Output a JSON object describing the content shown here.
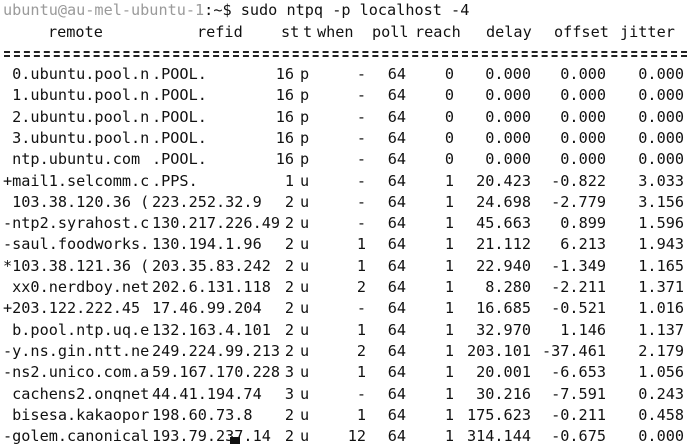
{
  "prompt": {
    "user_host": "ubuntu@au-mel-ubuntu-1",
    "path_symbol": ":~$",
    "command": " sudo ntpq -p localhost -4"
  },
  "columns": [
    "remote",
    "refid",
    "st",
    "t",
    "when",
    "poll",
    "reach",
    "delay",
    "offset",
    "jitter"
  ],
  "rows": [
    {
      "remote": " 0.ubuntu.pool.n",
      "refid": ".POOL.",
      "st": "16",
      "t": "p",
      "when": "-",
      "poll": "64",
      "reach": "0",
      "delay": "0.000",
      "offset": "0.000",
      "jitter": "0.000"
    },
    {
      "remote": " 1.ubuntu.pool.n",
      "refid": ".POOL.",
      "st": "16",
      "t": "p",
      "when": "-",
      "poll": "64",
      "reach": "0",
      "delay": "0.000",
      "offset": "0.000",
      "jitter": "0.000"
    },
    {
      "remote": " 2.ubuntu.pool.n",
      "refid": ".POOL.",
      "st": "16",
      "t": "p",
      "when": "-",
      "poll": "64",
      "reach": "0",
      "delay": "0.000",
      "offset": "0.000",
      "jitter": "0.000"
    },
    {
      "remote": " 3.ubuntu.pool.n",
      "refid": ".POOL.",
      "st": "16",
      "t": "p",
      "when": "-",
      "poll": "64",
      "reach": "0",
      "delay": "0.000",
      "offset": "0.000",
      "jitter": "0.000"
    },
    {
      "remote": " ntp.ubuntu.com",
      "refid": ".POOL.",
      "st": "16",
      "t": "p",
      "when": "-",
      "poll": "64",
      "reach": "0",
      "delay": "0.000",
      "offset": "0.000",
      "jitter": "0.000"
    },
    {
      "remote": "+mail1.selcomm.c",
      "refid": ".PPS.",
      "st": "1",
      "t": "u",
      "when": "-",
      "poll": "64",
      "reach": "1",
      "delay": "20.423",
      "offset": "-0.822",
      "jitter": "3.033"
    },
    {
      "remote": " 103.38.120.36 (",
      "refid": "223.252.32.9",
      "st": "2",
      "t": "u",
      "when": "-",
      "poll": "64",
      "reach": "1",
      "delay": "24.698",
      "offset": "-2.779",
      "jitter": "3.156"
    },
    {
      "remote": "-ntp2.syrahost.c",
      "refid": "130.217.226.49",
      "st": "2",
      "t": "u",
      "when": "-",
      "poll": "64",
      "reach": "1",
      "delay": "45.663",
      "offset": "0.899",
      "jitter": "1.596"
    },
    {
      "remote": "-saul.foodworks.",
      "refid": "130.194.1.96",
      "st": "2",
      "t": "u",
      "when": "1",
      "poll": "64",
      "reach": "1",
      "delay": "21.112",
      "offset": "6.213",
      "jitter": "1.943"
    },
    {
      "remote": "*103.38.121.36 (",
      "refid": "203.35.83.242",
      "st": "2",
      "t": "u",
      "when": "1",
      "poll": "64",
      "reach": "1",
      "delay": "22.940",
      "offset": "-1.349",
      "jitter": "1.165"
    },
    {
      "remote": " xx0.nerdboy.net",
      "refid": "202.6.131.118",
      "st": "2",
      "t": "u",
      "when": "2",
      "poll": "64",
      "reach": "1",
      "delay": "8.280",
      "offset": "-2.211",
      "jitter": "1.371"
    },
    {
      "remote": "+203.122.222.45",
      "refid": "17.46.99.204",
      "st": "2",
      "t": "u",
      "when": "-",
      "poll": "64",
      "reach": "1",
      "delay": "16.685",
      "offset": "-0.521",
      "jitter": "1.016"
    },
    {
      "remote": " b.pool.ntp.uq.e",
      "refid": "132.163.4.101",
      "st": "2",
      "t": "u",
      "when": "1",
      "poll": "64",
      "reach": "1",
      "delay": "32.970",
      "offset": "1.146",
      "jitter": "1.137"
    },
    {
      "remote": "-y.ns.gin.ntt.ne",
      "refid": "249.224.99.213",
      "st": "2",
      "t": "u",
      "when": "2",
      "poll": "64",
      "reach": "1",
      "delay": "203.101",
      "offset": "-37.461",
      "jitter": "2.179"
    },
    {
      "remote": "-ns2.unico.com.a",
      "refid": "59.167.170.228",
      "st": "3",
      "t": "u",
      "when": "1",
      "poll": "64",
      "reach": "1",
      "delay": "20.001",
      "offset": "-6.653",
      "jitter": "1.056"
    },
    {
      "remote": " cachens2.onqnet",
      "refid": "44.41.194.74",
      "st": "3",
      "t": "u",
      "when": "-",
      "poll": "64",
      "reach": "1",
      "delay": "30.216",
      "offset": "-7.591",
      "jitter": "0.243"
    },
    {
      "remote": " bisesa.kakaopor",
      "refid": "198.60.73.8",
      "st": "2",
      "t": "u",
      "when": "1",
      "poll": "64",
      "reach": "1",
      "delay": "175.623",
      "offset": "-0.211",
      "jitter": "0.458"
    },
    {
      "remote": "-golem.canonical",
      "refid": "193.79.237.14",
      "st": "2",
      "t": "u",
      "when": "12",
      "poll": "64",
      "reach": "1",
      "delay": "314.144",
      "offset": "-0.675",
      "jitter": "0.000"
    }
  ]
}
